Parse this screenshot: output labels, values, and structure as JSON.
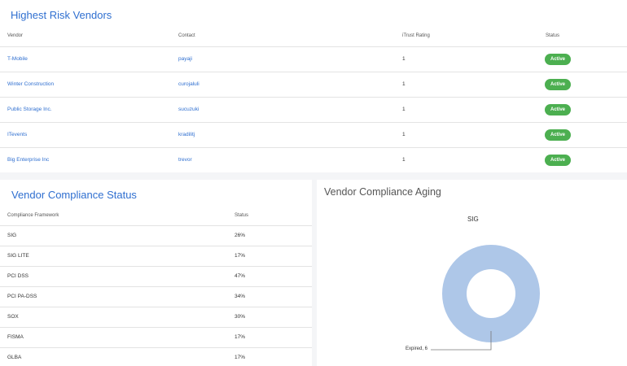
{
  "risk_vendors": {
    "title": "Highest Risk Vendors",
    "headers": {
      "vendor": "Vendor",
      "contact": "Contact",
      "rating": "iTrust Rating",
      "status": "Status"
    },
    "rows": [
      {
        "vendor": "T-Mobile",
        "contact": "payaji",
        "rating": "1",
        "status": "Active"
      },
      {
        "vendor": "Winter Construction",
        "contact": "curojaluli",
        "rating": "1",
        "status": "Active"
      },
      {
        "vendor": "Public Storage Inc.",
        "contact": "sucuzuki",
        "rating": "1",
        "status": "Active"
      },
      {
        "vendor": "ITevents",
        "contact": "kradilitj",
        "rating": "1",
        "status": "Active"
      },
      {
        "vendor": "Big Enterprise Inc",
        "contact": "trevor",
        "rating": "1",
        "status": "Active"
      }
    ],
    "status_color": "#4caf50"
  },
  "compliance_status": {
    "title": "Vendor Compliance Status",
    "headers": {
      "framework": "Compliance Framework",
      "status": "Status"
    },
    "rows": [
      {
        "framework": "SIG",
        "status": "26%"
      },
      {
        "framework": "SIG LITE",
        "status": "17%"
      },
      {
        "framework": "PCI DSS",
        "status": "47%"
      },
      {
        "framework": "PCI PA-DSS",
        "status": "34%"
      },
      {
        "framework": "SOX",
        "status": "30%"
      },
      {
        "framework": "FISMA",
        "status": "17%"
      },
      {
        "framework": "GLBA",
        "status": "17%"
      }
    ]
  },
  "compliance_aging": {
    "title": "Vendor Compliance Aging",
    "chart_data": {
      "type": "pie",
      "title": "SIG",
      "labels": [
        "Expired"
      ],
      "values": [
        6
      ],
      "data_labels": [
        "Expired, 6"
      ],
      "colors": [
        "#aec7e8"
      ],
      "donut": true
    }
  },
  "colors": {
    "title_blue": "#2f6fd0",
    "badge_green": "#4caf50",
    "donut_fill": "#aec7e8"
  }
}
